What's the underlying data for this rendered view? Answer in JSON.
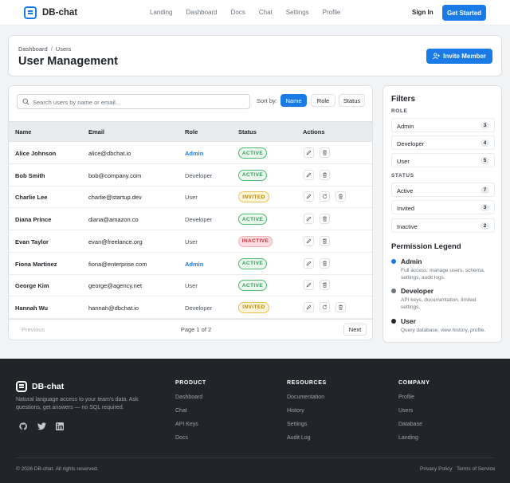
{
  "nav": {
    "brand": "DB-chat",
    "links": [
      "Landing",
      "Dashboard",
      "Docs",
      "Chat",
      "Settings",
      "Profile"
    ],
    "sign_in": "Sign In",
    "get_started": "Get Started"
  },
  "header": {
    "breadcrumb": [
      "Dashboard",
      "Users"
    ],
    "title": "User Management",
    "invite_label": "Invite Member"
  },
  "toolbar": {
    "search_placeholder": "Search users by name or email...",
    "sort_label": "Sort by:",
    "sort_options": [
      "Name",
      "Role",
      "Status"
    ],
    "sort_selected": "Name"
  },
  "table": {
    "columns": [
      "Name",
      "Email",
      "Role",
      "Status",
      "Actions"
    ],
    "rows": [
      {
        "name": "Alice Johnson",
        "email": "alice@dbchat.io",
        "role": "Admin",
        "status": "ACTIVE"
      },
      {
        "name": "Bob Smith",
        "email": "bob@company.com",
        "role": "Developer",
        "status": "ACTIVE"
      },
      {
        "name": "Charlie Lee",
        "email": "charlie@startup.dev",
        "role": "User",
        "status": "INVITED"
      },
      {
        "name": "Diana Prince",
        "email": "diana@amazon.co",
        "role": "Developer",
        "status": "ACTIVE"
      },
      {
        "name": "Evan Taylor",
        "email": "evan@freelance.org",
        "role": "User",
        "status": "INACTIVE"
      },
      {
        "name": "Fiona Martinez",
        "email": "fiona@enterprise.com",
        "role": "Admin",
        "status": "ACTIVE"
      },
      {
        "name": "George Kim",
        "email": "george@agency.net",
        "role": "User",
        "status": "ACTIVE"
      },
      {
        "name": "Hannah Wu",
        "email": "hannah@dbchat.io",
        "role": "Developer",
        "status": "INVITED"
      }
    ]
  },
  "pagination": {
    "prev": "Previous",
    "info": "Page 1 of 2",
    "next": "Next"
  },
  "filters": {
    "title": "Filters",
    "role_heading": "ROLE",
    "roles": [
      {
        "label": "Admin",
        "count": "3"
      },
      {
        "label": "Developer",
        "count": "4"
      },
      {
        "label": "User",
        "count": "5"
      }
    ],
    "status_heading": "STATUS",
    "statuses": [
      {
        "label": "Active",
        "count": "7"
      },
      {
        "label": "Invited",
        "count": "3"
      },
      {
        "label": "Inactive",
        "count": "2"
      }
    ]
  },
  "legend": {
    "title": "Permission Legend",
    "items": [
      {
        "name": "Admin",
        "desc": "Full access: manage users, schema, settings, audit logs.",
        "color": "#1a7ae6"
      },
      {
        "name": "Developer",
        "desc": "API keys, documentation, limited settings.",
        "color": "#6c757d"
      },
      {
        "name": "User",
        "desc": "Query database, view history, profile.",
        "color": "#212529"
      }
    ]
  },
  "footer": {
    "brand": "DB-chat",
    "tagline": "Natural language access to your team's data. Ask questions, get answers — no SQL required.",
    "columns": [
      {
        "title": "PRODUCT",
        "links": [
          "Dashboard",
          "Chat",
          "API Keys",
          "Docs"
        ]
      },
      {
        "title": "RESOURCES",
        "links": [
          "Documentation",
          "History",
          "Settings",
          "Audit Log"
        ]
      },
      {
        "title": "COMPANY",
        "links": [
          "Profile",
          "Users",
          "Database",
          "Landing"
        ]
      }
    ],
    "copyright": "© 2026 DB-chat. All rights reserved.",
    "legal": [
      "Privacy Policy",
      "Terms of Service"
    ]
  }
}
